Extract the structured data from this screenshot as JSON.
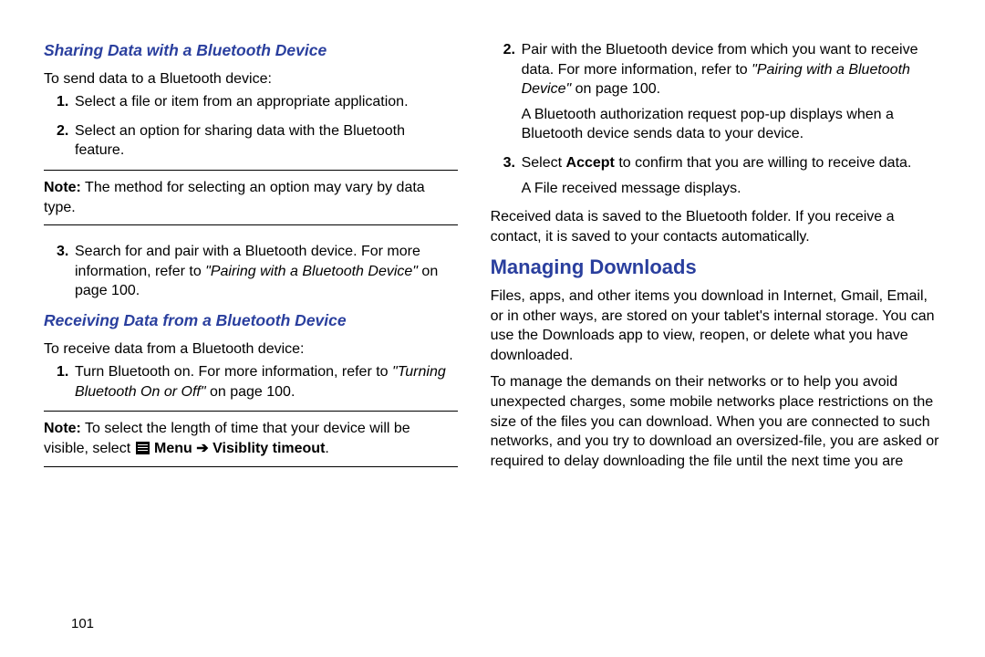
{
  "page_number": "101",
  "left": {
    "sharing": {
      "heading": "Sharing Data with a Bluetooth Device",
      "intro": "To send data to a Bluetooth device:",
      "step1": {
        "num": "1.",
        "text": "Select a file or item from an appropriate application."
      },
      "step2": {
        "num": "2.",
        "text": "Select an option for sharing data with the Bluetooth feature."
      },
      "note1": {
        "label": "Note:",
        "text": " The method for selecting an option may vary by data type."
      },
      "step3": {
        "num": "3.",
        "before": "Search for and pair with a Bluetooth device. For more information, refer to ",
        "ref": "\"Pairing with a Bluetooth Device\"",
        "after": " on page 100."
      }
    },
    "receiving": {
      "heading": "Receiving Data from a Bluetooth Device",
      "intro": "To receive data from a Bluetooth device:",
      "step1": {
        "num": "1.",
        "before": "Turn Bluetooth on. For more information, refer to ",
        "ref": "\"Turning Bluetooth On or Off\"",
        "after": " on page 100."
      },
      "note2": {
        "label": "Note:",
        "text_before": " To select the length of time that your device will be visible, select ",
        "menu_before": " Menu ",
        "arrow": "➔",
        "menu_after": " Visiblity timeout",
        "period": "."
      }
    }
  },
  "right": {
    "step2": {
      "num": "2.",
      "before": "Pair with the Bluetooth device from which you want to receive data. For more information, refer to ",
      "ref": "\"Pairing with a Bluetooth Device\"",
      "after": " on page 100."
    },
    "step2b": "A Bluetooth authorization request pop-up displays when a Bluetooth device sends data to your device.",
    "step3": {
      "num": "3.",
      "before": "Select ",
      "bold": "Accept",
      "after": " to confirm that you are willing to receive data."
    },
    "step3b": "A File received message displays.",
    "received_para": "Received data is saved to the Bluetooth folder. If you receive a contact, it is saved to your contacts automatically.",
    "managing": {
      "heading": "Managing Downloads",
      "para1": "Files, apps, and other items you download in Internet, Gmail, Email, or in other ways, are stored on your tablet's internal storage. You can use the Downloads app to view, reopen, or delete what you have downloaded.",
      "para2": "To manage the demands on their networks or to help you avoid unexpected charges, some mobile networks place restrictions on the size of the files you can download. When you are connected to such networks, and you try to download an oversized-file, you are asked or required to delay downloading the file until the next time you are"
    }
  }
}
